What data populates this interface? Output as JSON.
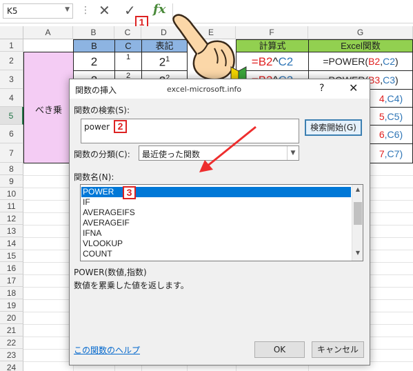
{
  "formula_bar": {
    "name_box": "K5",
    "cancel_icon": "✕",
    "enter_icon": "✓",
    "fx_label": "fx",
    "formula_text": "",
    "badge": "1"
  },
  "columns": [
    "A",
    "B",
    "C",
    "D",
    "E",
    "F",
    "G"
  ],
  "rows": [
    "1",
    "2",
    "3",
    "4",
    "5",
    "6",
    "7",
    "8",
    "9",
    "10",
    "11",
    "12",
    "13",
    "14",
    "15",
    "16",
    "17",
    "18",
    "19",
    "20",
    "21",
    "22",
    "23",
    "24"
  ],
  "sheet": {
    "header_row": {
      "B": "B",
      "C": "C",
      "D": "表記",
      "F": "計算式",
      "G": "Excel関数"
    },
    "a_label": "べき乗",
    "r2": {
      "B": "2",
      "C": "1",
      "D_base": "2",
      "D_exp": "1",
      "F": [
        "=",
        "B2",
        "^",
        "C2"
      ],
      "G": [
        "=POWER(",
        "B2",
        ",",
        "C2",
        ")"
      ]
    },
    "r3": {
      "B": "2",
      "C": "2",
      "D_base": "2",
      "D_exp": "2",
      "F": [
        "=",
        "B3",
        "^",
        "C3"
      ],
      "G": [
        "=POWER(",
        "B3",
        ",",
        "C3",
        ")"
      ]
    },
    "partial": {
      "r4": [
        "4",
        ",C4)"
      ],
      "r5": [
        "5",
        ",C5)"
      ],
      "r6": [
        "6",
        ",C6)"
      ],
      "r7": [
        "7",
        ",C7)"
      ]
    }
  },
  "dialog": {
    "title": "関数の挿入",
    "help_btn": "?",
    "close_btn": "✕",
    "search_label": "関数の検索(S):",
    "search_value": "power",
    "search_badge": "2",
    "search_button": "検索開始(G)",
    "category_label": "関数の分類(C):",
    "category_value": "最近使った関数",
    "list_label": "関数名(N):",
    "list_badge": "3",
    "functions": [
      "POWER",
      "IF",
      "AVERAGEIFS",
      "AVERAGEIF",
      "IFNA",
      "VLOOKUP",
      "COUNT"
    ],
    "signature": "POWER(数値,指数)",
    "description": "数値を累乗した値を返します。",
    "help_link": "この関数のヘルプ",
    "ok_button": "OK",
    "cancel_button": "キャンセル"
  },
  "watermark": "excel-microsoft.info",
  "colors": {
    "header_green": "#92d050",
    "header_blue": "#8db4e2",
    "pink": "#f4ccf4",
    "red": "#e02020",
    "blue": "#2e75b6",
    "badge_red": "#dd2222",
    "selection": "#0078d7"
  }
}
